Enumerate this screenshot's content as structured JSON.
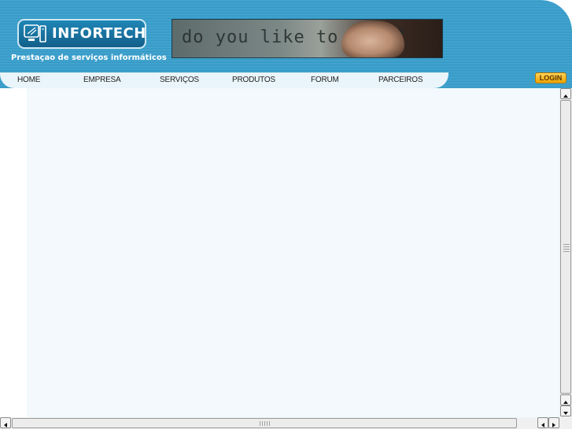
{
  "header": {
    "logo_text": "INFORTECH",
    "tagline": "Prestaçao de serviços informáticos",
    "banner_text": "do you like to play?"
  },
  "nav": {
    "items": [
      {
        "label": "HOME"
      },
      {
        "label": "EMPRESA"
      },
      {
        "label": "SERVIÇOS"
      },
      {
        "label": "PRODUTOS"
      },
      {
        "label": "FORUM"
      },
      {
        "label": "PARCEIROS"
      }
    ],
    "login_label": "LOGIN"
  },
  "colors": {
    "header_blue": "#2f95c2",
    "nav_bg": "#e9f5fb",
    "login_orange": "#f0a400",
    "content_bg": "#f3f9fc"
  },
  "icons": {
    "logo": "computer-monitor-icon"
  }
}
